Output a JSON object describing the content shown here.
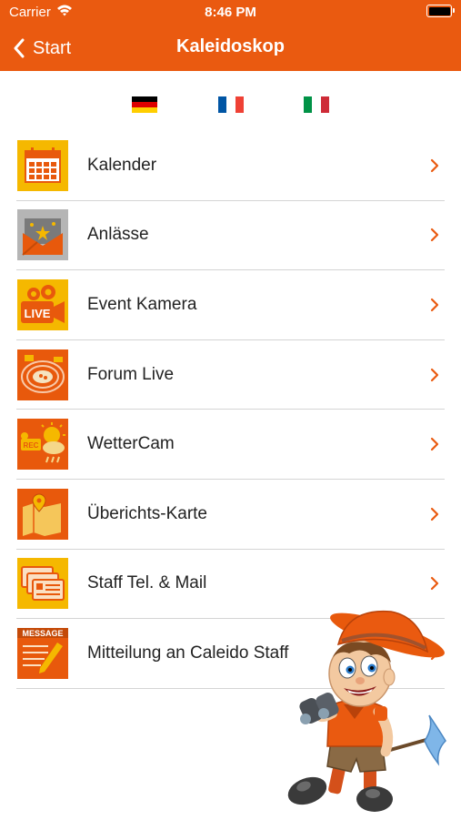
{
  "status_bar": {
    "carrier": "Carrier",
    "time": "8:46 PM"
  },
  "nav": {
    "back_label": "Start",
    "title": "Kaleidoskop"
  },
  "colors": {
    "accent": "#ea5a10",
    "yellow": "#f5b800",
    "chevron": "#ea5a10",
    "divider": "#d4d4d4"
  },
  "flags": [
    {
      "icon": "flag-de-icon"
    },
    {
      "icon": "flag-fr-icon"
    },
    {
      "icon": "flag-it-icon"
    }
  ],
  "menu": [
    {
      "label": "Kalender",
      "icon": "calendar-icon"
    },
    {
      "label": "Anlässe",
      "icon": "envelope-icon"
    },
    {
      "label": "Event Kamera",
      "icon": "live-camera-icon"
    },
    {
      "label": "Forum Live",
      "icon": "forum-arena-icon"
    },
    {
      "label": "WetterCam",
      "icon": "weather-cam-icon"
    },
    {
      "label": "Überichts-Karte",
      "icon": "map-icon"
    },
    {
      "label": "Staff Tel. & Mail",
      "icon": "contact-cards-icon"
    },
    {
      "label": "Mitteilung an Caleido Staff",
      "icon": "message-icon"
    }
  ]
}
